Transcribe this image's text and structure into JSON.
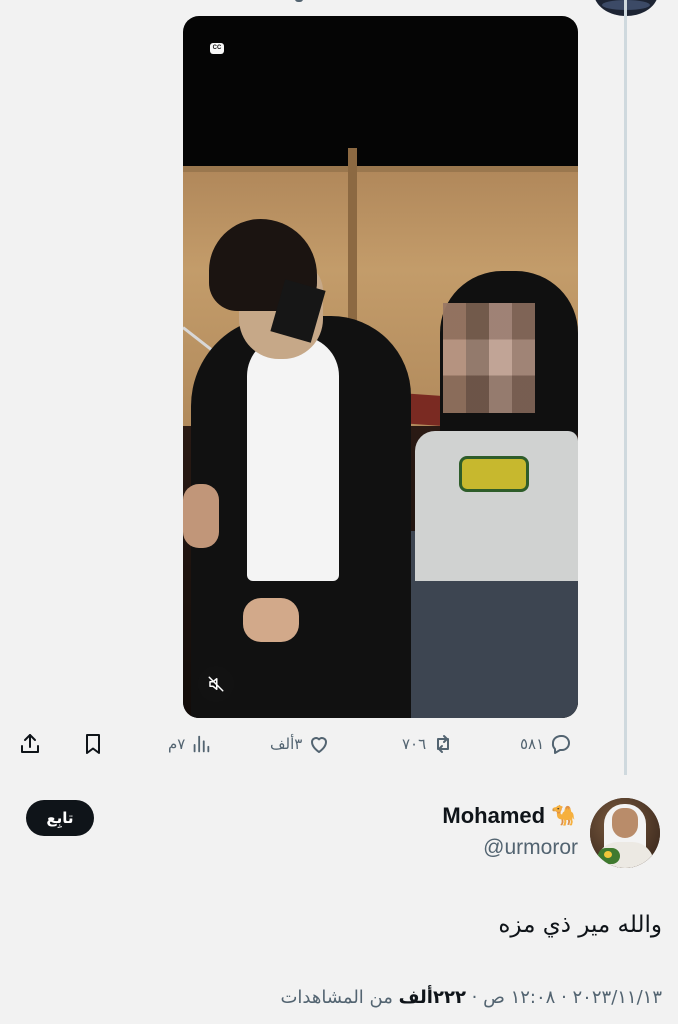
{
  "video": {
    "cc_label": "CC"
  },
  "actions": {
    "replies": "٥٨١",
    "retweets": "٧٠٦",
    "likes": "٣ألف",
    "views": "٧م"
  },
  "author": {
    "display_name": "Mohamed",
    "emoji": "🐪",
    "handle": "@urmoror"
  },
  "follow_label": "تابِع",
  "tweet_text": "والله مير ذي مزه",
  "meta": {
    "date": "٢٠٢٣/١١/١٣",
    "separator1": " · ",
    "time": "١٢:٠٨ ص",
    "separator2": " · ",
    "views_count": "٢٢٢ألف",
    "views_label": " من المشاهدات"
  },
  "colors": {
    "background": "#f2f2f2",
    "text": "#0f1419",
    "muted": "#536471",
    "thread_line": "#cfd9de"
  }
}
